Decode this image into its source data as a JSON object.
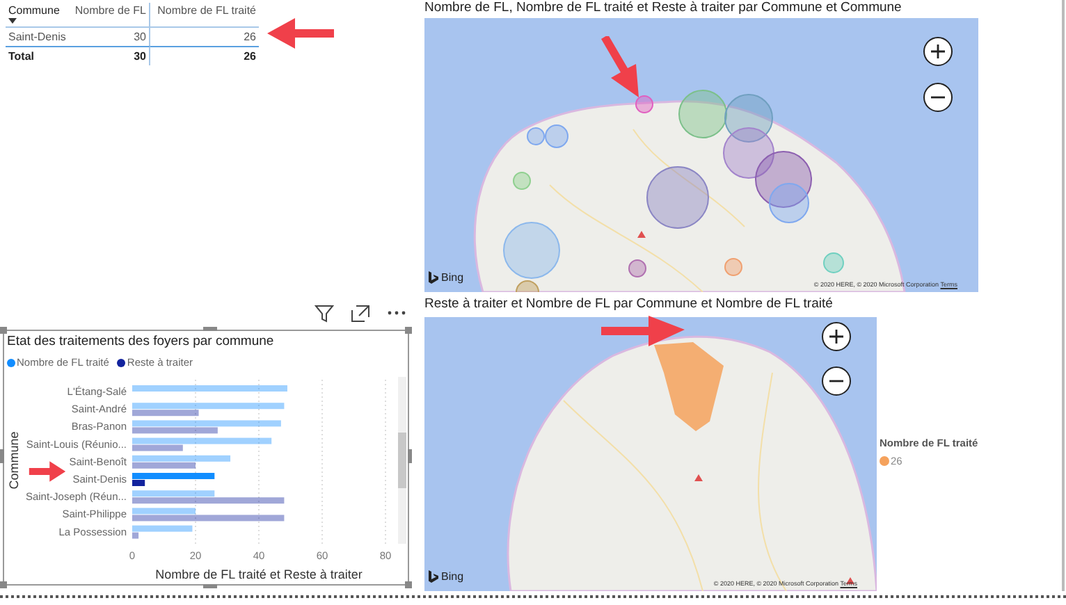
{
  "table": {
    "columns": [
      {
        "label": "Commune",
        "sorted": true
      },
      {
        "label": "Nombre de FL",
        "sorted": false
      },
      {
        "label": "Nombre de FL traité",
        "sorted": false
      }
    ],
    "rows": [
      [
        "Saint-Denis",
        "30",
        "26"
      ]
    ],
    "total": [
      "Total",
      "30",
      "26"
    ]
  },
  "map_top": {
    "title": "Nombre de FL, Nombre de FL traité et Reste à traiter par Commune et Commune",
    "logo": "Bing",
    "copyright": "© 2020 HERE, © 2020 Microsoft Corporation",
    "terms": "Terms"
  },
  "bar_visual": {
    "chart_data": {
      "type": "bar",
      "orientation": "horizontal",
      "title": "Etat des traitements des foyers par commune",
      "xlabel": "Nombre de FL traité et Reste à traiter",
      "ylabel": "Commune",
      "categories": [
        "L'Étang-Salé",
        "Saint-André",
        "Bras-Panon",
        "Saint-Louis (Réunio...",
        "Saint-Benoît",
        "Saint-Denis",
        "Saint-Joseph (Réun...",
        "Saint-Philippe",
        "La Possession"
      ],
      "series": [
        {
          "name": "Nombre de FL traité",
          "color": "#118dff",
          "values": [
            49,
            48,
            47,
            44,
            31,
            26,
            26,
            20,
            19
          ]
        },
        {
          "name": "Reste à traiter",
          "color": "#12239e",
          "values": [
            null,
            21,
            27,
            16,
            20,
            4,
            48,
            48,
            2
          ]
        }
      ],
      "grid": true,
      "xlim": [
        0,
        80
      ],
      "xticks": [
        0,
        20,
        40,
        60,
        80
      ]
    },
    "category_states": [
      {
        "selected": false
      },
      {
        "selected": false
      },
      {
        "selected": false
      },
      {
        "selected": false
      },
      {
        "selected": false
      },
      {
        "selected": true
      },
      {
        "selected": false
      },
      {
        "selected": false
      },
      {
        "selected": false
      }
    ]
  },
  "map_bottom": {
    "title": "Reste à traiter et Nombre de FL par Commune et Nombre de FL traité",
    "logo": "Bing",
    "copyright": "© 2020 HERE, © 2020 Microsoft Corporation",
    "terms": "Terms",
    "legend": {
      "title": "Nombre de FL traité",
      "items": [
        {
          "label": "26",
          "color": "#f5a25d"
        }
      ]
    }
  }
}
